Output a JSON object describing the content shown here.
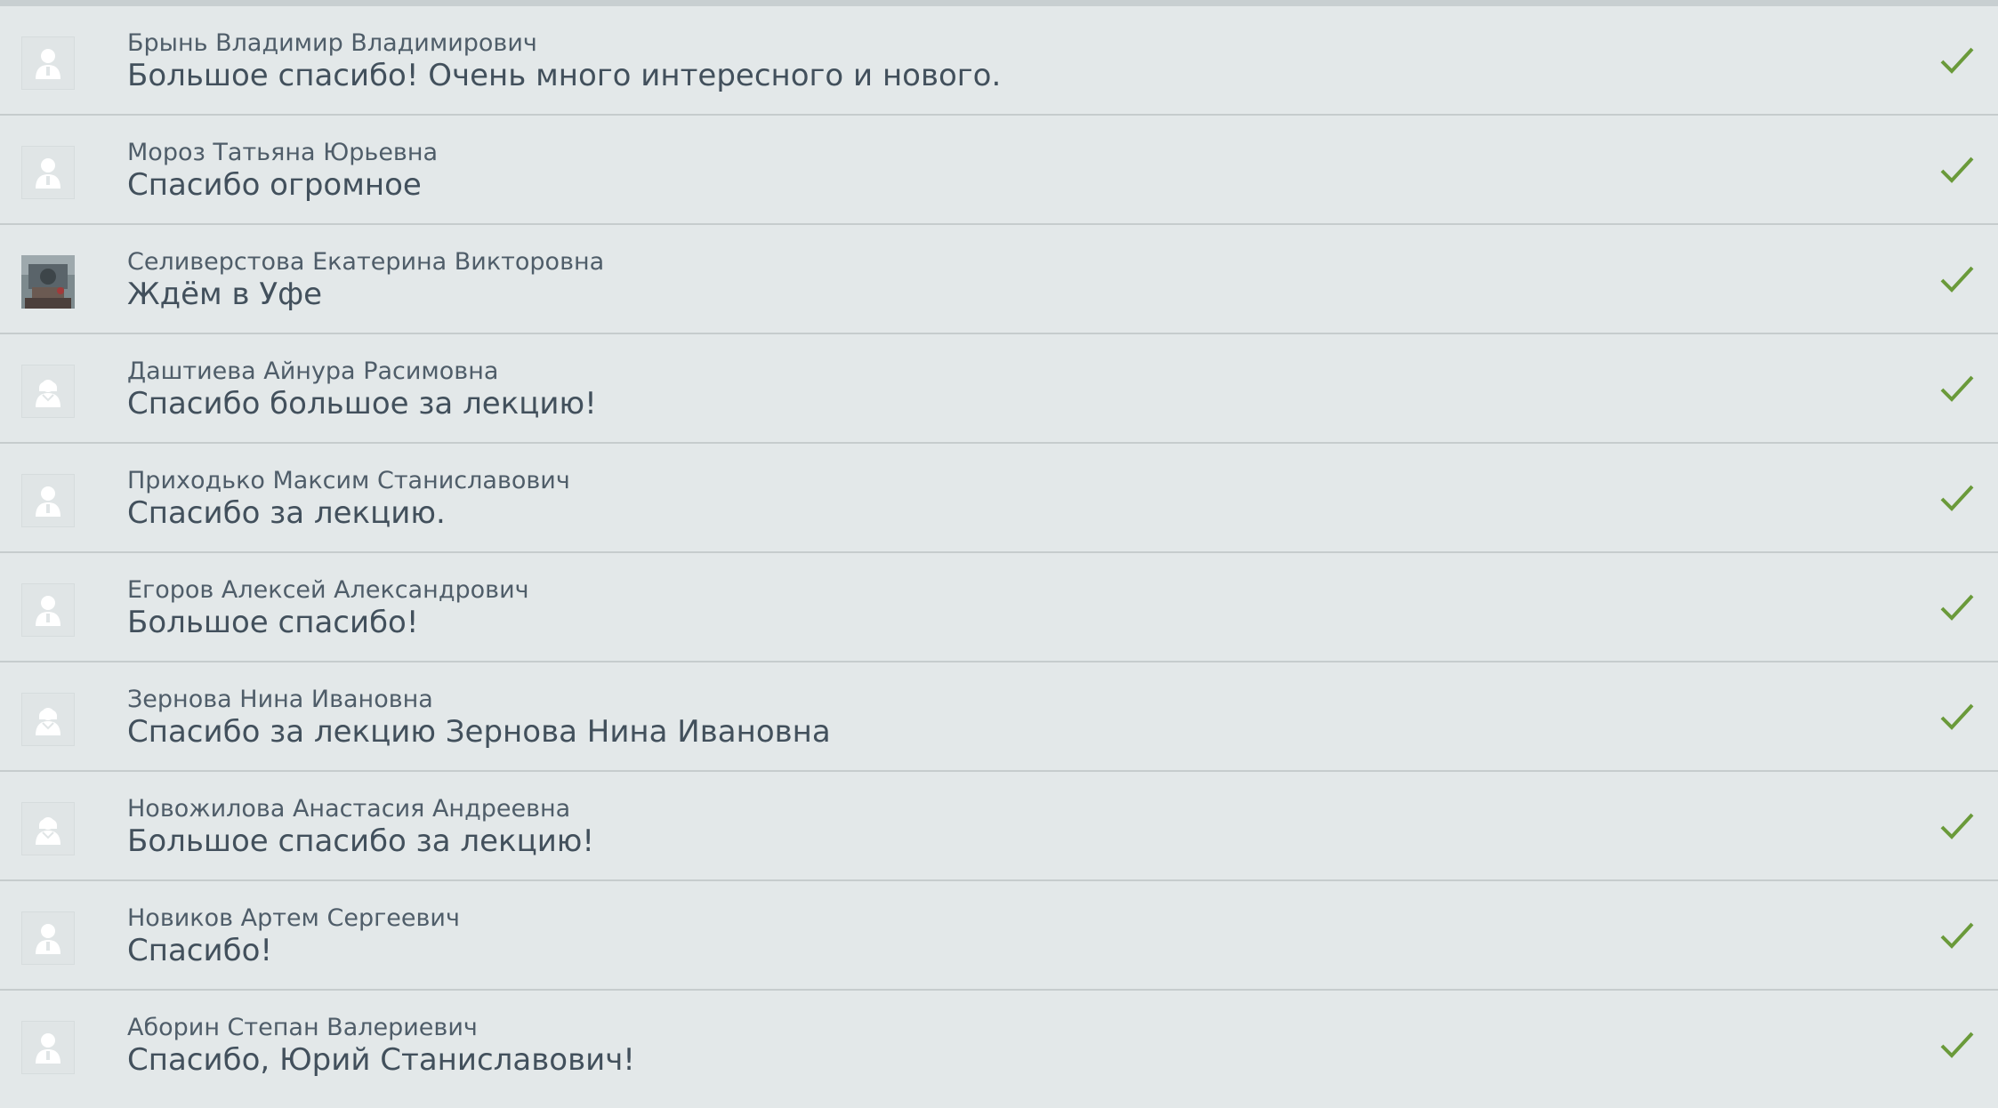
{
  "comments": [
    {
      "author": "Брынь Владимир Владимирович",
      "text": "Большое спасибо! Очень много интересного и нового.",
      "avatar": "male-placeholder-icon",
      "approved": true
    },
    {
      "author": "Мороз Татьяна Юрьевна",
      "text": "Спасибо огромное",
      "avatar": "male-placeholder-icon",
      "approved": true
    },
    {
      "author": "Селиверстова Екатерина Викторовна",
      "text": "Ждём в Уфе",
      "avatar": "photo",
      "approved": true
    },
    {
      "author": "Даштиева Айнура Расимовна",
      "text": "Спасибо большое за лекцию!",
      "avatar": "female-placeholder-icon",
      "approved": true
    },
    {
      "author": "Приходько Максим Станиславович",
      "text": "Спасибо за лекцию.",
      "avatar": "male-placeholder-icon",
      "approved": true
    },
    {
      "author": "Егоров Алексей Александрович",
      "text": "Большое спасибо!",
      "avatar": "male-placeholder-icon",
      "approved": true
    },
    {
      "author": "Зернова Нина Ивановна",
      "text": "Спасибо за лекцию Зернова Нина Ивановна",
      "avatar": "female-placeholder-icon",
      "approved": true
    },
    {
      "author": "Новожилова Анастасия Андреевна",
      "text": "Большое спасибо за лекцию!",
      "avatar": "female-placeholder-icon",
      "approved": true
    },
    {
      "author": "Новиков Артем Сергеевич",
      "text": "Спасибо!",
      "avatar": "male-placeholder-icon",
      "approved": true
    },
    {
      "author": "Аборин Степан Валериевич",
      "text": "Спасибо, Юрий Станиславович!",
      "avatar": "male-placeholder-icon",
      "approved": true
    }
  ],
  "colors": {
    "background": "#e3e8e9",
    "divider": "#c6cccd",
    "check": "#6a9a3a",
    "author_text": "#4f5d69",
    "message_text": "#42505c"
  }
}
